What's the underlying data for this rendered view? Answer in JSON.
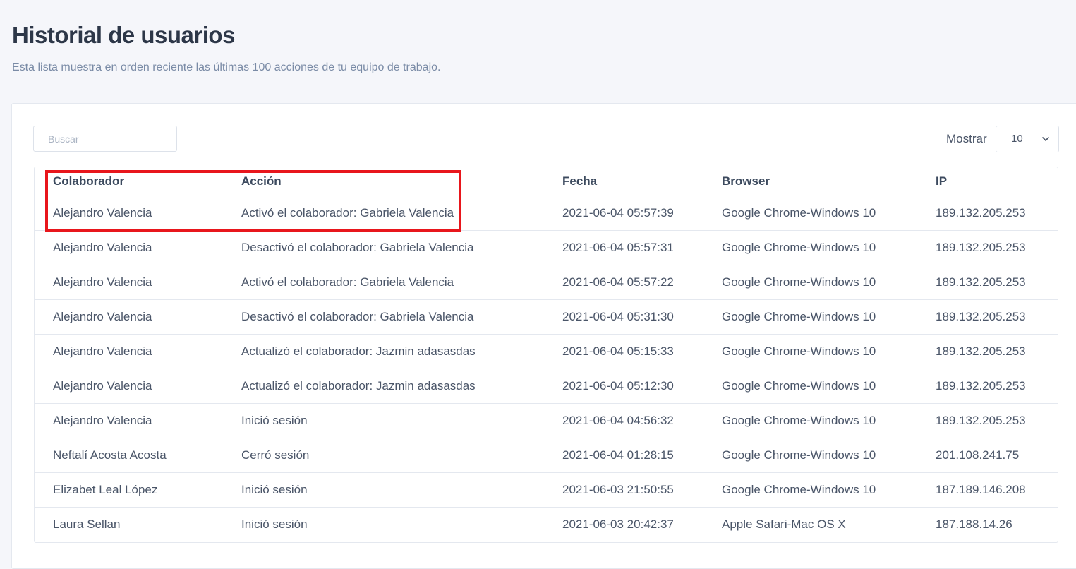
{
  "page": {
    "title": "Historial de usuarios",
    "subtitle": "Esta lista muestra en orden reciente las últimas 100 acciones de tu equipo de trabajo."
  },
  "toolbar": {
    "search_placeholder": "Buscar",
    "show_label": "Mostrar",
    "show_value": "10",
    "chevron_icon": "chevron-down-icon"
  },
  "table": {
    "columns": [
      "Colaborador",
      "Acción",
      "Fecha",
      "Browser",
      "IP"
    ],
    "rows": [
      [
        "Alejandro Valencia",
        "Activó el colaborador: Gabriela Valencia",
        "2021-06-04 05:57:39",
        "Google Chrome-Windows 10",
        "189.132.205.253"
      ],
      [
        "Alejandro Valencia",
        "Desactivó el colaborador: Gabriela Valencia",
        "2021-06-04 05:57:31",
        "Google Chrome-Windows 10",
        "189.132.205.253"
      ],
      [
        "Alejandro Valencia",
        "Activó el colaborador: Gabriela Valencia",
        "2021-06-04 05:57:22",
        "Google Chrome-Windows 10",
        "189.132.205.253"
      ],
      [
        "Alejandro Valencia",
        "Desactivó el colaborador: Gabriela Valencia",
        "2021-06-04 05:31:30",
        "Google Chrome-Windows 10",
        "189.132.205.253"
      ],
      [
        "Alejandro Valencia",
        "Actualizó el colaborador: Jazmin adasasdas",
        "2021-06-04 05:15:33",
        "Google Chrome-Windows 10",
        "189.132.205.253"
      ],
      [
        "Alejandro Valencia",
        "Actualizó el colaborador: Jazmin adasasdas",
        "2021-06-04 05:12:30",
        "Google Chrome-Windows 10",
        "189.132.205.253"
      ],
      [
        "Alejandro Valencia",
        "Inició sesión",
        "2021-06-04 04:56:32",
        "Google Chrome-Windows 10",
        "189.132.205.253"
      ],
      [
        "Neftalí Acosta Acosta",
        "Cerró sesión",
        "2021-06-04 01:28:15",
        "Google Chrome-Windows 10",
        "201.108.241.75"
      ],
      [
        "Elizabet Leal López",
        "Inició sesión",
        "2021-06-03 21:50:55",
        "Google Chrome-Windows 10",
        "187.189.146.208"
      ],
      [
        "Laura Sellan",
        "Inició sesión",
        "2021-06-03 20:42:37",
        "Apple Safari-Mac OS X",
        "187.188.14.26"
      ]
    ]
  },
  "colors": {
    "highlight": "#e8161c",
    "background": "#f5f6fa",
    "title": "#2d3748"
  }
}
